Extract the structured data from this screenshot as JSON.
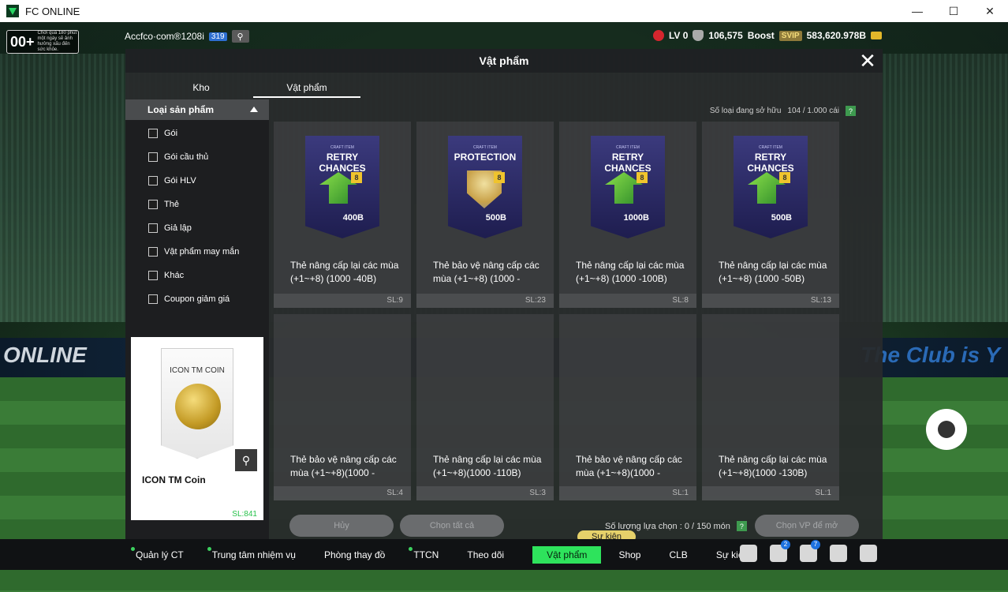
{
  "window": {
    "title": "FC ONLINE",
    "minimize": "—",
    "maximize": "☐",
    "close": "✕"
  },
  "age_badge": {
    "label": "00+",
    "note": "Chơi quá 180 phút một ngày sẽ ảnh hưởng xấu đến sức khỏe."
  },
  "topbar": {
    "account": "Accfco·com®1208i",
    "uid": "319",
    "search_icon": "⚲"
  },
  "stats": {
    "level": "LV 0",
    "power": "106,575",
    "boost_label": "Boost",
    "svip": "SVIP",
    "coins": "583,620.978B"
  },
  "modal": {
    "title": "Vật phẩm",
    "close": "✕",
    "tabs": [
      {
        "label": "Kho"
      },
      {
        "label": "Vật phẩm"
      }
    ],
    "category_header": "Loại sản phẩm",
    "categories": [
      {
        "label": "Gói"
      },
      {
        "label": "Gói cầu thủ"
      },
      {
        "label": "Gói HLV"
      },
      {
        "label": "Thẻ"
      },
      {
        "label": "Giả lập"
      },
      {
        "label": "Vật phẩm may mắn"
      },
      {
        "label": "Khác"
      },
      {
        "label": "Coupon giảm giá"
      }
    ],
    "preview": {
      "card_label": "ICON TM COIN",
      "title": "ICON TM Coin",
      "sl": "SL:841",
      "zoom_icon": "⚲"
    },
    "owned": {
      "label": "Số loại đang sở hữu",
      "value": "104 / 1.000 cái",
      "help": "?"
    },
    "items": [
      {
        "card_top": "CRAFT ITEM",
        "card_label": "RETRY CHANCES",
        "amount": "400B",
        "badge": "8",
        "name": "Thẻ nâng cấp lại các mùa (+1~+8) (1000 -40B)",
        "sl": "SL:9"
      },
      {
        "card_top": "CRAFT ITEM",
        "card_label": "PROTECTION",
        "amount": "500B",
        "badge": "8",
        "name": "Thẻ bảo vệ nâng cấp các mùa (+1~+8) (1000 -",
        "sl": "SL:23"
      },
      {
        "card_top": "CRAFT ITEM",
        "card_label": "RETRY CHANCES",
        "amount": "1000B",
        "badge": "8",
        "name": "Thẻ nâng cấp lại các mùa (+1~+8) (1000 -100B)",
        "sl": "SL:8"
      },
      {
        "card_top": "CRAFT ITEM",
        "card_label": "RETRY CHANCES",
        "amount": "500B",
        "badge": "8",
        "name": "Thẻ nâng cấp lại các mùa (+1~+8) (1000 -50B)",
        "sl": "SL:13"
      }
    ],
    "items_row2": [
      {
        "name": "Thẻ bảo vệ nâng cấp các mùa (+1~+8)(1000 -",
        "sl": "SL:4"
      },
      {
        "name": "Thẻ nâng cấp lại các mùa (+1~+8)(1000 -110B)",
        "sl": "SL:3"
      },
      {
        "name": "Thẻ bảo vệ nâng cấp các mùa (+1~+8)(1000 -",
        "sl": "SL:1"
      },
      {
        "name": "Thẻ nâng cấp lại các mùa (+1~+8)(1000 -130B)",
        "sl": "SL:1"
      }
    ],
    "footer": {
      "cancel": "Hủy",
      "select_all": "Chọn tất cả",
      "selected_label": "Số lượng lựa chọn : 0 / 150 món",
      "help": "?",
      "open_btn": "Chọn VP để mở"
    }
  },
  "background": {
    "banner_left": "ONLINE",
    "banner_right": "The Club is Y"
  },
  "event_tag": "Sự kiện",
  "navbar": {
    "items": [
      {
        "label": "Quản lý CT"
      },
      {
        "label": "Trung tâm nhiệm vụ"
      },
      {
        "label": "Phòng thay đồ"
      },
      {
        "label": "TTCN"
      },
      {
        "label": "Theo dõi"
      },
      {
        "label": "Vật phẩm"
      },
      {
        "label": "Shop"
      },
      {
        "label": "CLB"
      },
      {
        "label": "Sự kiện"
      }
    ],
    "badges": {
      "home": "2",
      "bell": "7"
    }
  }
}
